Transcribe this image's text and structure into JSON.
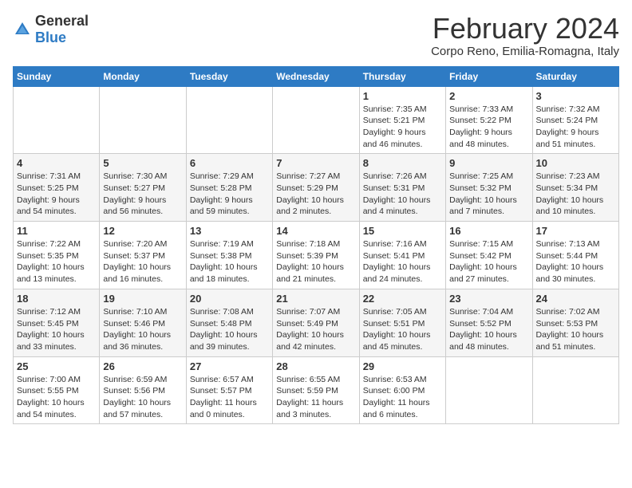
{
  "header": {
    "logo_general": "General",
    "logo_blue": "Blue",
    "main_title": "February 2024",
    "subtitle": "Corpo Reno, Emilia-Romagna, Italy"
  },
  "calendar": {
    "days_of_week": [
      "Sunday",
      "Monday",
      "Tuesday",
      "Wednesday",
      "Thursday",
      "Friday",
      "Saturday"
    ],
    "weeks": [
      {
        "shaded": false,
        "days": [
          {
            "num": "",
            "info": ""
          },
          {
            "num": "",
            "info": ""
          },
          {
            "num": "",
            "info": ""
          },
          {
            "num": "",
            "info": ""
          },
          {
            "num": "1",
            "info": "Sunrise: 7:35 AM\nSunset: 5:21 PM\nDaylight: 9 hours\nand 46 minutes."
          },
          {
            "num": "2",
            "info": "Sunrise: 7:33 AM\nSunset: 5:22 PM\nDaylight: 9 hours\nand 48 minutes."
          },
          {
            "num": "3",
            "info": "Sunrise: 7:32 AM\nSunset: 5:24 PM\nDaylight: 9 hours\nand 51 minutes."
          }
        ]
      },
      {
        "shaded": true,
        "days": [
          {
            "num": "4",
            "info": "Sunrise: 7:31 AM\nSunset: 5:25 PM\nDaylight: 9 hours\nand 54 minutes."
          },
          {
            "num": "5",
            "info": "Sunrise: 7:30 AM\nSunset: 5:27 PM\nDaylight: 9 hours\nand 56 minutes."
          },
          {
            "num": "6",
            "info": "Sunrise: 7:29 AM\nSunset: 5:28 PM\nDaylight: 9 hours\nand 59 minutes."
          },
          {
            "num": "7",
            "info": "Sunrise: 7:27 AM\nSunset: 5:29 PM\nDaylight: 10 hours\nand 2 minutes."
          },
          {
            "num": "8",
            "info": "Sunrise: 7:26 AM\nSunset: 5:31 PM\nDaylight: 10 hours\nand 4 minutes."
          },
          {
            "num": "9",
            "info": "Sunrise: 7:25 AM\nSunset: 5:32 PM\nDaylight: 10 hours\nand 7 minutes."
          },
          {
            "num": "10",
            "info": "Sunrise: 7:23 AM\nSunset: 5:34 PM\nDaylight: 10 hours\nand 10 minutes."
          }
        ]
      },
      {
        "shaded": false,
        "days": [
          {
            "num": "11",
            "info": "Sunrise: 7:22 AM\nSunset: 5:35 PM\nDaylight: 10 hours\nand 13 minutes."
          },
          {
            "num": "12",
            "info": "Sunrise: 7:20 AM\nSunset: 5:37 PM\nDaylight: 10 hours\nand 16 minutes."
          },
          {
            "num": "13",
            "info": "Sunrise: 7:19 AM\nSunset: 5:38 PM\nDaylight: 10 hours\nand 18 minutes."
          },
          {
            "num": "14",
            "info": "Sunrise: 7:18 AM\nSunset: 5:39 PM\nDaylight: 10 hours\nand 21 minutes."
          },
          {
            "num": "15",
            "info": "Sunrise: 7:16 AM\nSunset: 5:41 PM\nDaylight: 10 hours\nand 24 minutes."
          },
          {
            "num": "16",
            "info": "Sunrise: 7:15 AM\nSunset: 5:42 PM\nDaylight: 10 hours\nand 27 minutes."
          },
          {
            "num": "17",
            "info": "Sunrise: 7:13 AM\nSunset: 5:44 PM\nDaylight: 10 hours\nand 30 minutes."
          }
        ]
      },
      {
        "shaded": true,
        "days": [
          {
            "num": "18",
            "info": "Sunrise: 7:12 AM\nSunset: 5:45 PM\nDaylight: 10 hours\nand 33 minutes."
          },
          {
            "num": "19",
            "info": "Sunrise: 7:10 AM\nSunset: 5:46 PM\nDaylight: 10 hours\nand 36 minutes."
          },
          {
            "num": "20",
            "info": "Sunrise: 7:08 AM\nSunset: 5:48 PM\nDaylight: 10 hours\nand 39 minutes."
          },
          {
            "num": "21",
            "info": "Sunrise: 7:07 AM\nSunset: 5:49 PM\nDaylight: 10 hours\nand 42 minutes."
          },
          {
            "num": "22",
            "info": "Sunrise: 7:05 AM\nSunset: 5:51 PM\nDaylight: 10 hours\nand 45 minutes."
          },
          {
            "num": "23",
            "info": "Sunrise: 7:04 AM\nSunset: 5:52 PM\nDaylight: 10 hours\nand 48 minutes."
          },
          {
            "num": "24",
            "info": "Sunrise: 7:02 AM\nSunset: 5:53 PM\nDaylight: 10 hours\nand 51 minutes."
          }
        ]
      },
      {
        "shaded": false,
        "days": [
          {
            "num": "25",
            "info": "Sunrise: 7:00 AM\nSunset: 5:55 PM\nDaylight: 10 hours\nand 54 minutes."
          },
          {
            "num": "26",
            "info": "Sunrise: 6:59 AM\nSunset: 5:56 PM\nDaylight: 10 hours\nand 57 minutes."
          },
          {
            "num": "27",
            "info": "Sunrise: 6:57 AM\nSunset: 5:57 PM\nDaylight: 11 hours\nand 0 minutes."
          },
          {
            "num": "28",
            "info": "Sunrise: 6:55 AM\nSunset: 5:59 PM\nDaylight: 11 hours\nand 3 minutes."
          },
          {
            "num": "29",
            "info": "Sunrise: 6:53 AM\nSunset: 6:00 PM\nDaylight: 11 hours\nand 6 minutes."
          },
          {
            "num": "",
            "info": ""
          },
          {
            "num": "",
            "info": ""
          }
        ]
      }
    ]
  }
}
